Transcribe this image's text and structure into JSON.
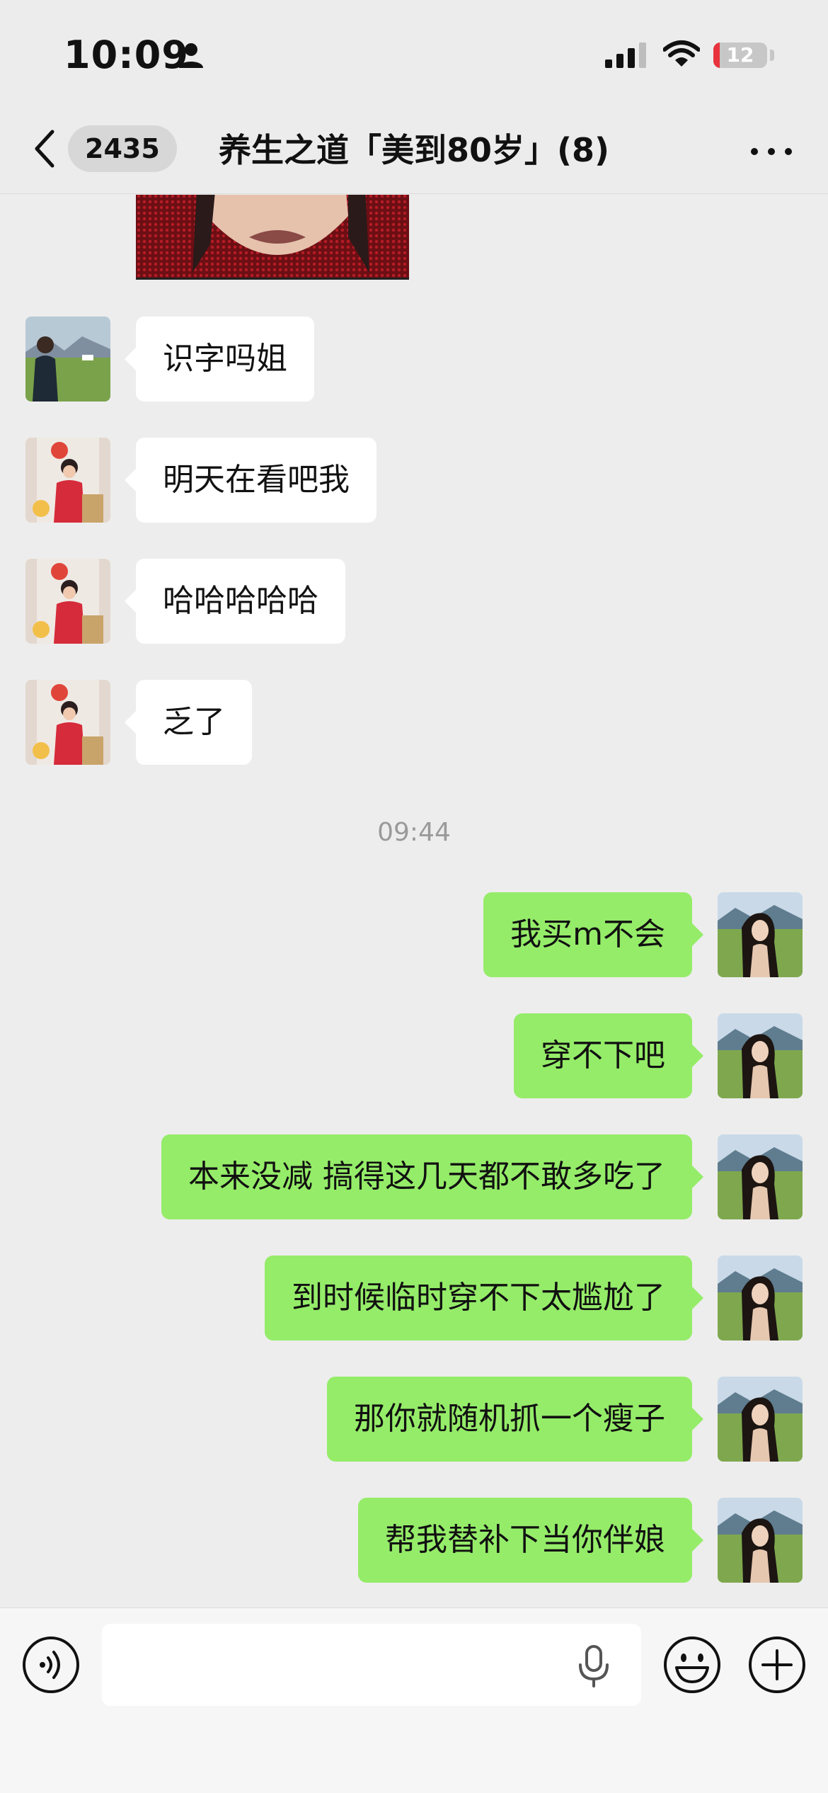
{
  "status_bar": {
    "time": "10:09",
    "battery": "12",
    "battery_level": 0.12
  },
  "header": {
    "unread_count": "2435",
    "title": "养生之道「美到80岁」(8)",
    "icons": {
      "back": "chevron-left-icon",
      "more": "more-dots-icon"
    }
  },
  "messages": {
    "incoming": [
      {
        "avatar": "avatar-woman-field",
        "text": "识字吗姐"
      },
      {
        "avatar": "avatar-girl-red-flower",
        "text": "明天在看吧我"
      },
      {
        "avatar": "avatar-girl-red-flower",
        "text": "哈哈哈哈哈"
      },
      {
        "avatar": "avatar-girl-red-flower",
        "text": "乏了"
      }
    ],
    "timestamp": "09:44",
    "outgoing": [
      {
        "avatar": "avatar-self-meadow",
        "text": "我买m不会"
      },
      {
        "avatar": "avatar-self-meadow",
        "text": "穿不下吧"
      },
      {
        "avatar": "avatar-self-meadow",
        "text": "本来没减 搞得这几天都不敢多吃了"
      },
      {
        "avatar": "avatar-self-meadow",
        "text": "到时候临时穿不下太尴尬了"
      },
      {
        "avatar": "avatar-self-meadow",
        "text": "那你就随机抓一个瘦子"
      },
      {
        "avatar": "avatar-self-meadow",
        "text": "帮我替补下当你伴娘"
      }
    ]
  },
  "input_bar": {
    "value": "",
    "icons": [
      "voice-icon",
      "mic-icon",
      "emoji-icon",
      "plus-icon"
    ]
  },
  "colors": {
    "background": "#ededed",
    "outgoing_bubble": "#95ec69",
    "incoming_bubble": "#ffffff",
    "timestamp": "#9a9a9a",
    "battery_low": "#e8333c"
  }
}
